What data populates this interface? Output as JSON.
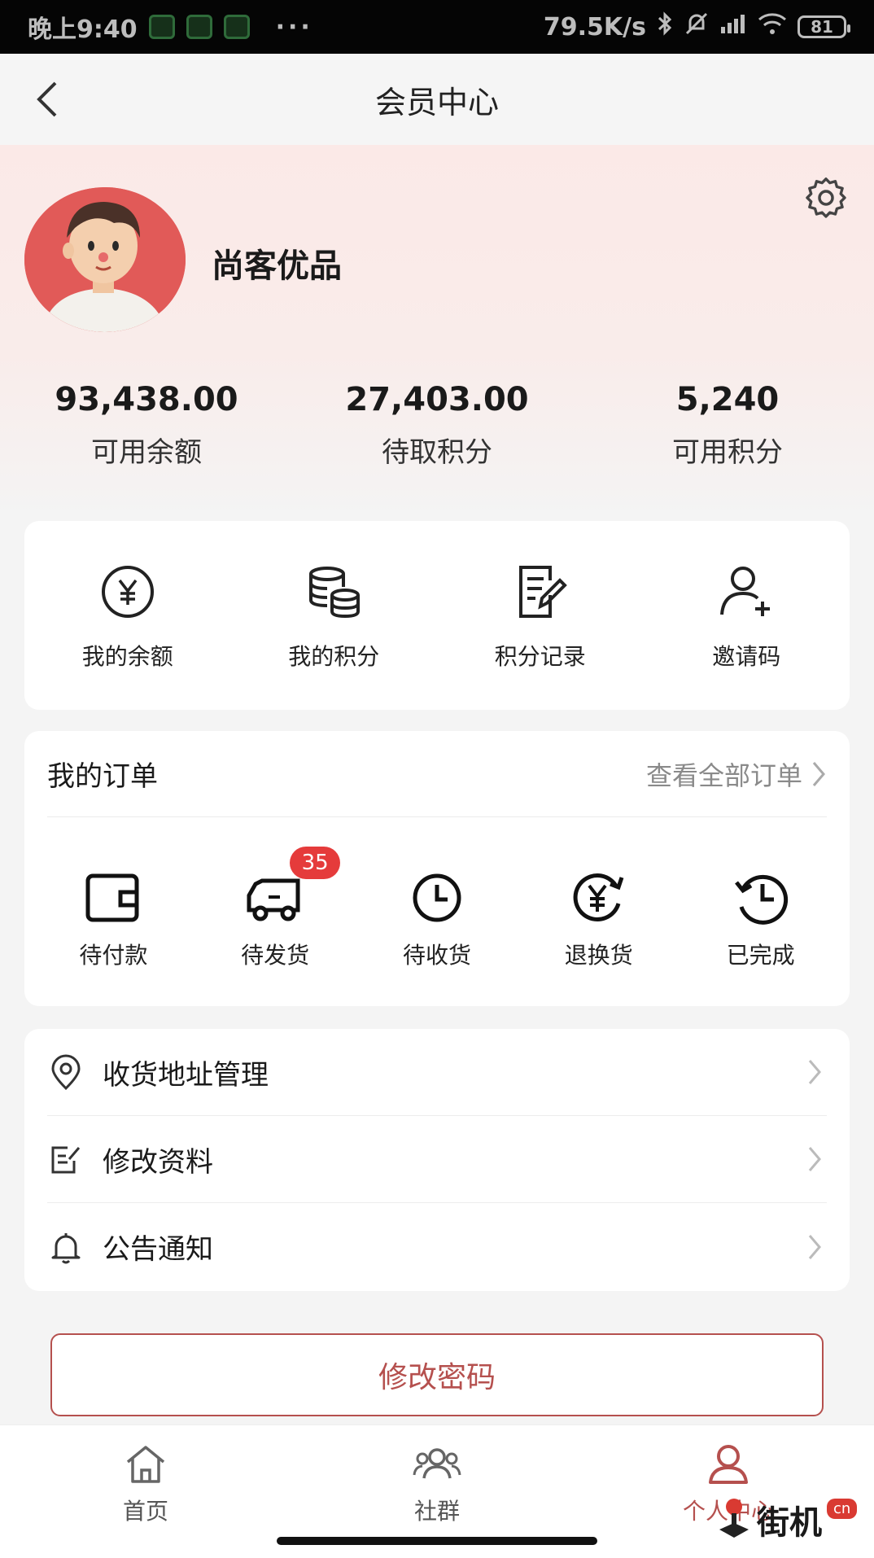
{
  "status_bar": {
    "time": "晚上9:40",
    "dots": "···",
    "network_speed": "79.5K/s",
    "battery": "81"
  },
  "nav": {
    "title": "会员中心"
  },
  "profile": {
    "username": "尚客优品"
  },
  "stats": [
    {
      "value": "93,438.00",
      "label": "可用余额"
    },
    {
      "value": "27,403.00",
      "label": "待取积分"
    },
    {
      "value": "5,240",
      "label": "可用积分"
    }
  ],
  "quick_actions": [
    {
      "label": "我的余额",
      "icon": "yen-circle-icon"
    },
    {
      "label": "我的积分",
      "icon": "coin-stack-icon"
    },
    {
      "label": "积分记录",
      "icon": "document-edit-icon"
    },
    {
      "label": "邀请码",
      "icon": "user-add-icon"
    }
  ],
  "orders": {
    "title": "我的订单",
    "view_all": "查看全部订单",
    "items": [
      {
        "label": "待付款",
        "icon": "wallet-icon"
      },
      {
        "label": "待发货",
        "icon": "truck-icon",
        "badge": "35"
      },
      {
        "label": "待收货",
        "icon": "clock-icon"
      },
      {
        "label": "退换货",
        "icon": "yen-refresh-icon"
      },
      {
        "label": "已完成",
        "icon": "history-clock-icon"
      }
    ]
  },
  "menu": [
    {
      "label": "收货地址管理",
      "icon": "location-pin-icon"
    },
    {
      "label": "修改资料",
      "icon": "edit-profile-icon"
    },
    {
      "label": "公告通知",
      "icon": "bell-icon"
    }
  ],
  "change_password": "修改密码",
  "tabs": [
    {
      "label": "首页",
      "icon": "home-icon"
    },
    {
      "label": "社群",
      "icon": "group-icon"
    },
    {
      "label": "个人中心",
      "icon": "person-icon",
      "active": true
    }
  ],
  "watermark": {
    "text": "街机",
    "suffix": "cn"
  },
  "colors": {
    "accent": "#b5504e",
    "badge": "#e53b3b",
    "avatar_bg": "#e15a58"
  }
}
